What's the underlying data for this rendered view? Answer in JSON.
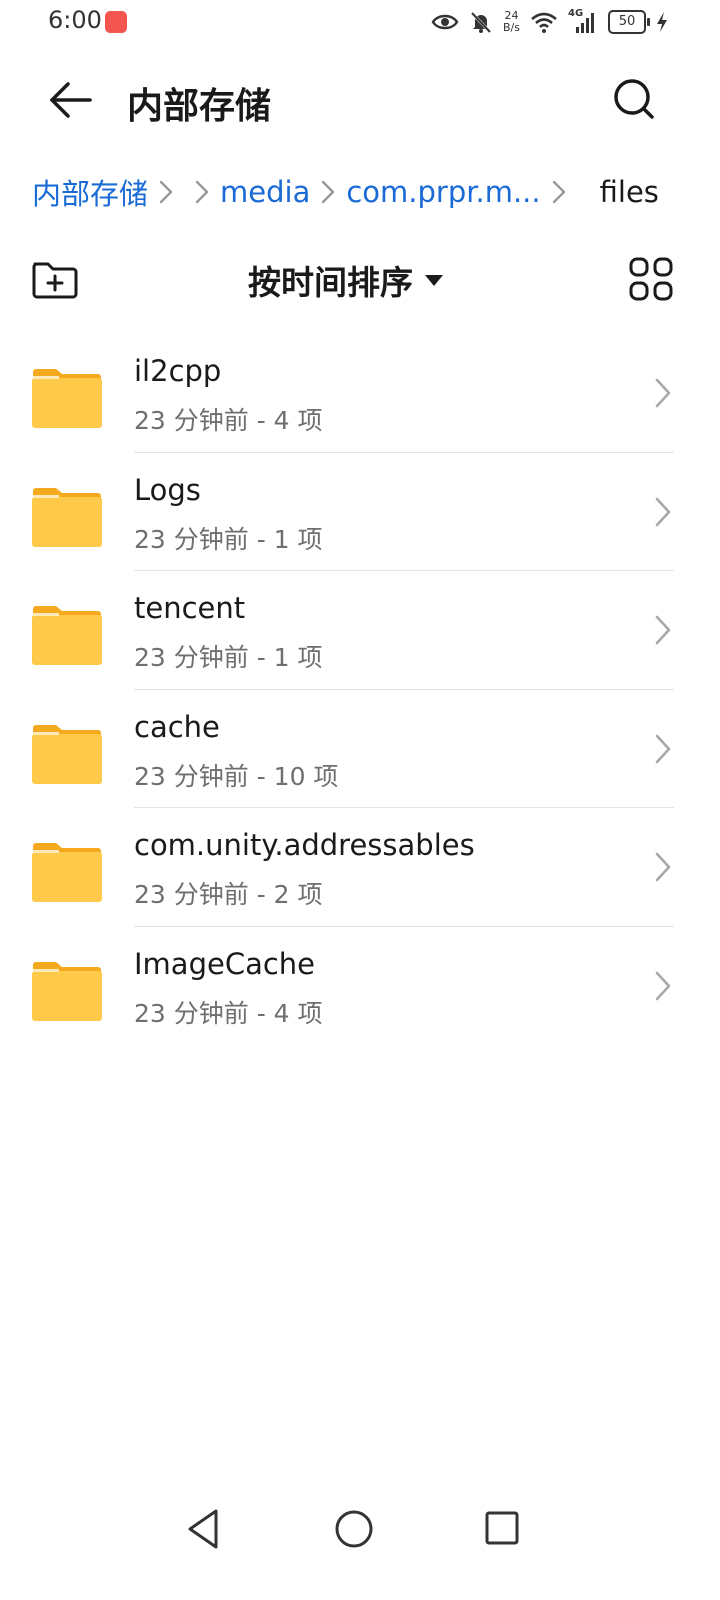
{
  "status_bar": {
    "time": "6:00",
    "net_speed_value": "24",
    "net_speed_unit": "B/s",
    "network_type": "4G",
    "battery": "50"
  },
  "header": {
    "title": "内部存储"
  },
  "breadcrumb": [
    {
      "label": "内部存储"
    },
    {
      "label": "media"
    },
    {
      "label": "com.prpr.m..."
    },
    {
      "label": "files"
    }
  ],
  "toolbar": {
    "sort_label": "按时间排序"
  },
  "files": [
    {
      "name": "il2cpp",
      "meta": "23 分钟前 - 4 项"
    },
    {
      "name": "Logs",
      "meta": "23 分钟前 - 1 项"
    },
    {
      "name": "tencent",
      "meta": "23 分钟前 - 1 项"
    },
    {
      "name": "cache",
      "meta": "23 分钟前 - 10 项"
    },
    {
      "name": "com.unity.addressables",
      "meta": "23 分钟前 - 2 项"
    },
    {
      "name": "ImageCache",
      "meta": "23 分钟前 - 4 项"
    }
  ],
  "colors": {
    "link": "#1a6bd6",
    "folder": "#ffc94a",
    "folder_tab": "#f4a91f"
  }
}
